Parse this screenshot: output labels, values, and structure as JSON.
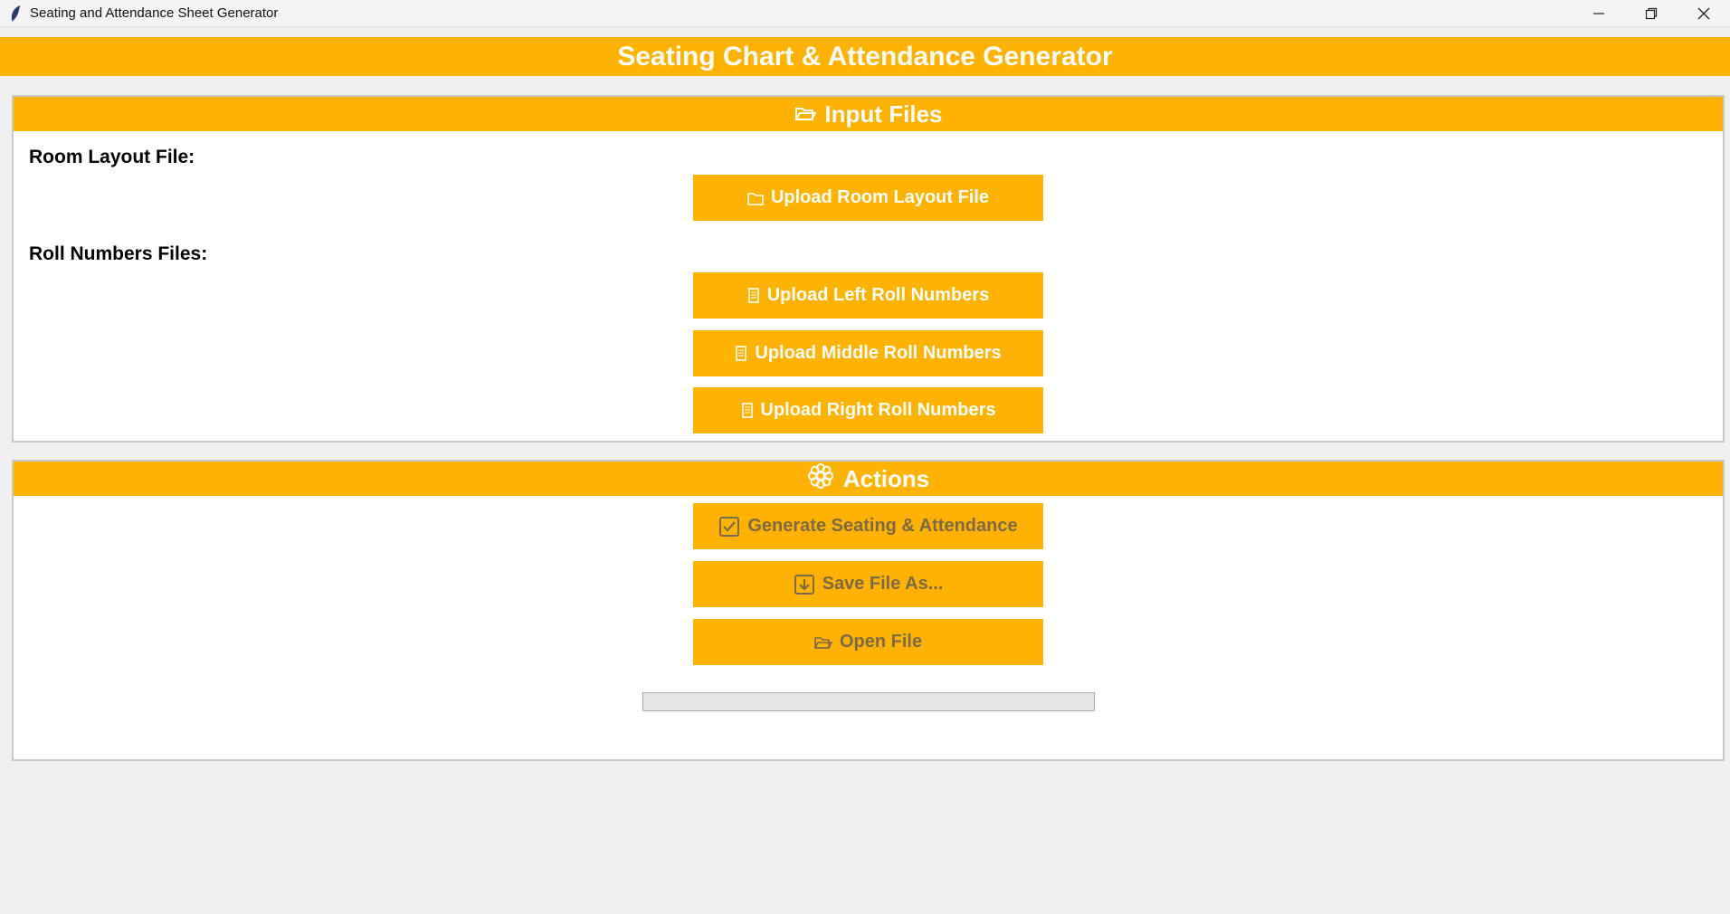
{
  "window": {
    "title": "Seating and Attendance Sheet Generator"
  },
  "header": {
    "title": "Seating Chart & Attendance Generator"
  },
  "input_files": {
    "heading": "Input Files",
    "room_layout_label": "Room Layout File:",
    "upload_room_layout": "Upload Room Layout File",
    "roll_numbers_label": "Roll Numbers Files:",
    "upload_left": "Upload Left Roll Numbers",
    "upload_middle": "Upload Middle Roll Numbers",
    "upload_right": "Upload Right Roll Numbers"
  },
  "actions": {
    "heading": "Actions",
    "generate": "Generate Seating & Attendance",
    "save": "Save File As...",
    "open": "Open File",
    "progress": 0
  },
  "colors": {
    "accent": "#ffb300",
    "panel_bg": "#ffffff",
    "window_bg": "#f0f0f0"
  },
  "icons": {
    "app": "feather-icon",
    "folder": "folder-icon",
    "document": "document-icon",
    "settings": "gear-icon",
    "check": "checkbox-icon",
    "download": "download-icon"
  }
}
